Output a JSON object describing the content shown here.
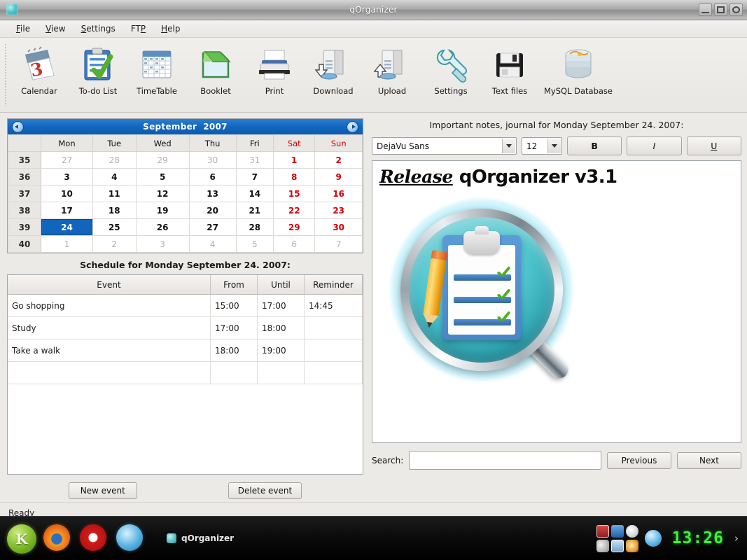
{
  "window": {
    "title": "qOrganizer",
    "app_icon": "qorganizer-icon",
    "minimize_label": "Minimize",
    "maximize_label": "Maximize",
    "close_label": "Close"
  },
  "menubar": {
    "items": [
      {
        "label": "File",
        "accel": "F"
      },
      {
        "label": "View",
        "accel": "V"
      },
      {
        "label": "Settings",
        "accel": "S"
      },
      {
        "label": "FTP",
        "accel": "P"
      },
      {
        "label": "Help",
        "accel": "H"
      }
    ]
  },
  "toolbar": {
    "items": [
      {
        "label": "Calendar",
        "icon": "calendar-icon"
      },
      {
        "label": "To-do List",
        "icon": "todo-list-icon"
      },
      {
        "label": "TimeTable",
        "icon": "timetable-icon"
      },
      {
        "label": "Booklet",
        "icon": "booklet-icon"
      },
      {
        "label": "Print",
        "icon": "printer-icon"
      },
      {
        "label": "Download",
        "icon": "download-server-icon"
      },
      {
        "label": "Upload",
        "icon": "upload-server-icon"
      },
      {
        "label": "Settings",
        "icon": "wrench-screwdriver-icon"
      },
      {
        "label": "Text files",
        "icon": "floppy-disk-icon"
      },
      {
        "label": "MySQL Database",
        "icon": "database-icon"
      }
    ]
  },
  "calendar": {
    "month": "September",
    "year": "2007",
    "prev_label": "Previous month",
    "next_label": "Next month",
    "weekday_headers": [
      "Mon",
      "Tue",
      "Wed",
      "Thu",
      "Fri",
      "Sat",
      "Sun"
    ],
    "week_numbers": [
      "35",
      "36",
      "37",
      "38",
      "39",
      "40"
    ],
    "rows": [
      {
        "week": "35",
        "days": [
          {
            "d": "27",
            "out": true
          },
          {
            "d": "28",
            "out": true
          },
          {
            "d": "29",
            "out": true
          },
          {
            "d": "30",
            "out": true
          },
          {
            "d": "31",
            "out": true
          },
          {
            "d": "1",
            "we": true
          },
          {
            "d": "2",
            "we": true
          }
        ]
      },
      {
        "week": "36",
        "days": [
          {
            "d": "3"
          },
          {
            "d": "4"
          },
          {
            "d": "5"
          },
          {
            "d": "6"
          },
          {
            "d": "7"
          },
          {
            "d": "8",
            "we": true
          },
          {
            "d": "9",
            "we": true
          }
        ]
      },
      {
        "week": "37",
        "days": [
          {
            "d": "10"
          },
          {
            "d": "11"
          },
          {
            "d": "12"
          },
          {
            "d": "13"
          },
          {
            "d": "14"
          },
          {
            "d": "15",
            "we": true
          },
          {
            "d": "16",
            "we": true
          }
        ]
      },
      {
        "week": "38",
        "days": [
          {
            "d": "17"
          },
          {
            "d": "18"
          },
          {
            "d": "19"
          },
          {
            "d": "20"
          },
          {
            "d": "21"
          },
          {
            "d": "22",
            "we": true
          },
          {
            "d": "23",
            "we": true
          }
        ]
      },
      {
        "week": "39",
        "days": [
          {
            "d": "24",
            "sel": true
          },
          {
            "d": "25"
          },
          {
            "d": "26"
          },
          {
            "d": "27"
          },
          {
            "d": "28"
          },
          {
            "d": "29",
            "we": true
          },
          {
            "d": "30",
            "we": true
          }
        ]
      },
      {
        "week": "40",
        "days": [
          {
            "d": "1",
            "out": true
          },
          {
            "d": "2",
            "out": true
          },
          {
            "d": "3",
            "out": true
          },
          {
            "d": "4",
            "out": true
          },
          {
            "d": "5",
            "out": true
          },
          {
            "d": "6",
            "out": true
          },
          {
            "d": "7",
            "out": true
          }
        ]
      }
    ],
    "selected_day": "24"
  },
  "schedule": {
    "title": "Schedule for Monday September 24. 2007:",
    "columns": [
      "Event",
      "From",
      "Until",
      "Reminder"
    ],
    "rows": [
      {
        "event": "Go shopping",
        "from": "15:00",
        "until": "17:00",
        "reminder": "14:45"
      },
      {
        "event": "Study",
        "from": "17:00",
        "until": "18:00",
        "reminder": ""
      },
      {
        "event": "Take a walk",
        "from": "18:00",
        "until": "19:00",
        "reminder": ""
      },
      {
        "event": "",
        "from": "",
        "until": "",
        "reminder": ""
      }
    ],
    "new_event_label": "New event",
    "delete_event_label": "Delete event"
  },
  "notes": {
    "title": "Important notes, journal for Monday September 24. 2007:",
    "font_family_value": "DejaVu Sans",
    "font_size_value": "12",
    "bold_label": "B",
    "italic_label": "I",
    "underline_label": "U",
    "heading_em": "Release",
    "heading_rest": "qOrganizer v3.1",
    "logo_alt": "qorganizer-logo"
  },
  "search": {
    "label": "Search:",
    "value": "",
    "placeholder": "",
    "previous_label": "Previous",
    "next_label": "Next"
  },
  "statusbar": {
    "text": "Ready"
  },
  "taskbar": {
    "launchers": [
      {
        "name": "kde-menu-icon",
        "glyph": "K"
      },
      {
        "name": "firefox-icon",
        "glyph": ""
      },
      {
        "name": "opera-icon",
        "glyph": ""
      },
      {
        "name": "konqueror-icon",
        "glyph": ""
      }
    ],
    "task_button_label": "qOrganizer",
    "tray_icons": [
      "keyboard-layout-icon",
      "network-icon",
      "cloud-icon",
      "speaker-icon",
      "photo-icon",
      "warning-icon",
      "globe-icon"
    ],
    "clock": "13:26",
    "tray_arrow": "›"
  },
  "colors": {
    "accent_blue": "#1165bc",
    "weekend_red": "#d40000",
    "clock_green": "#3cf23c",
    "logo_teal": "#4cc3cc"
  }
}
